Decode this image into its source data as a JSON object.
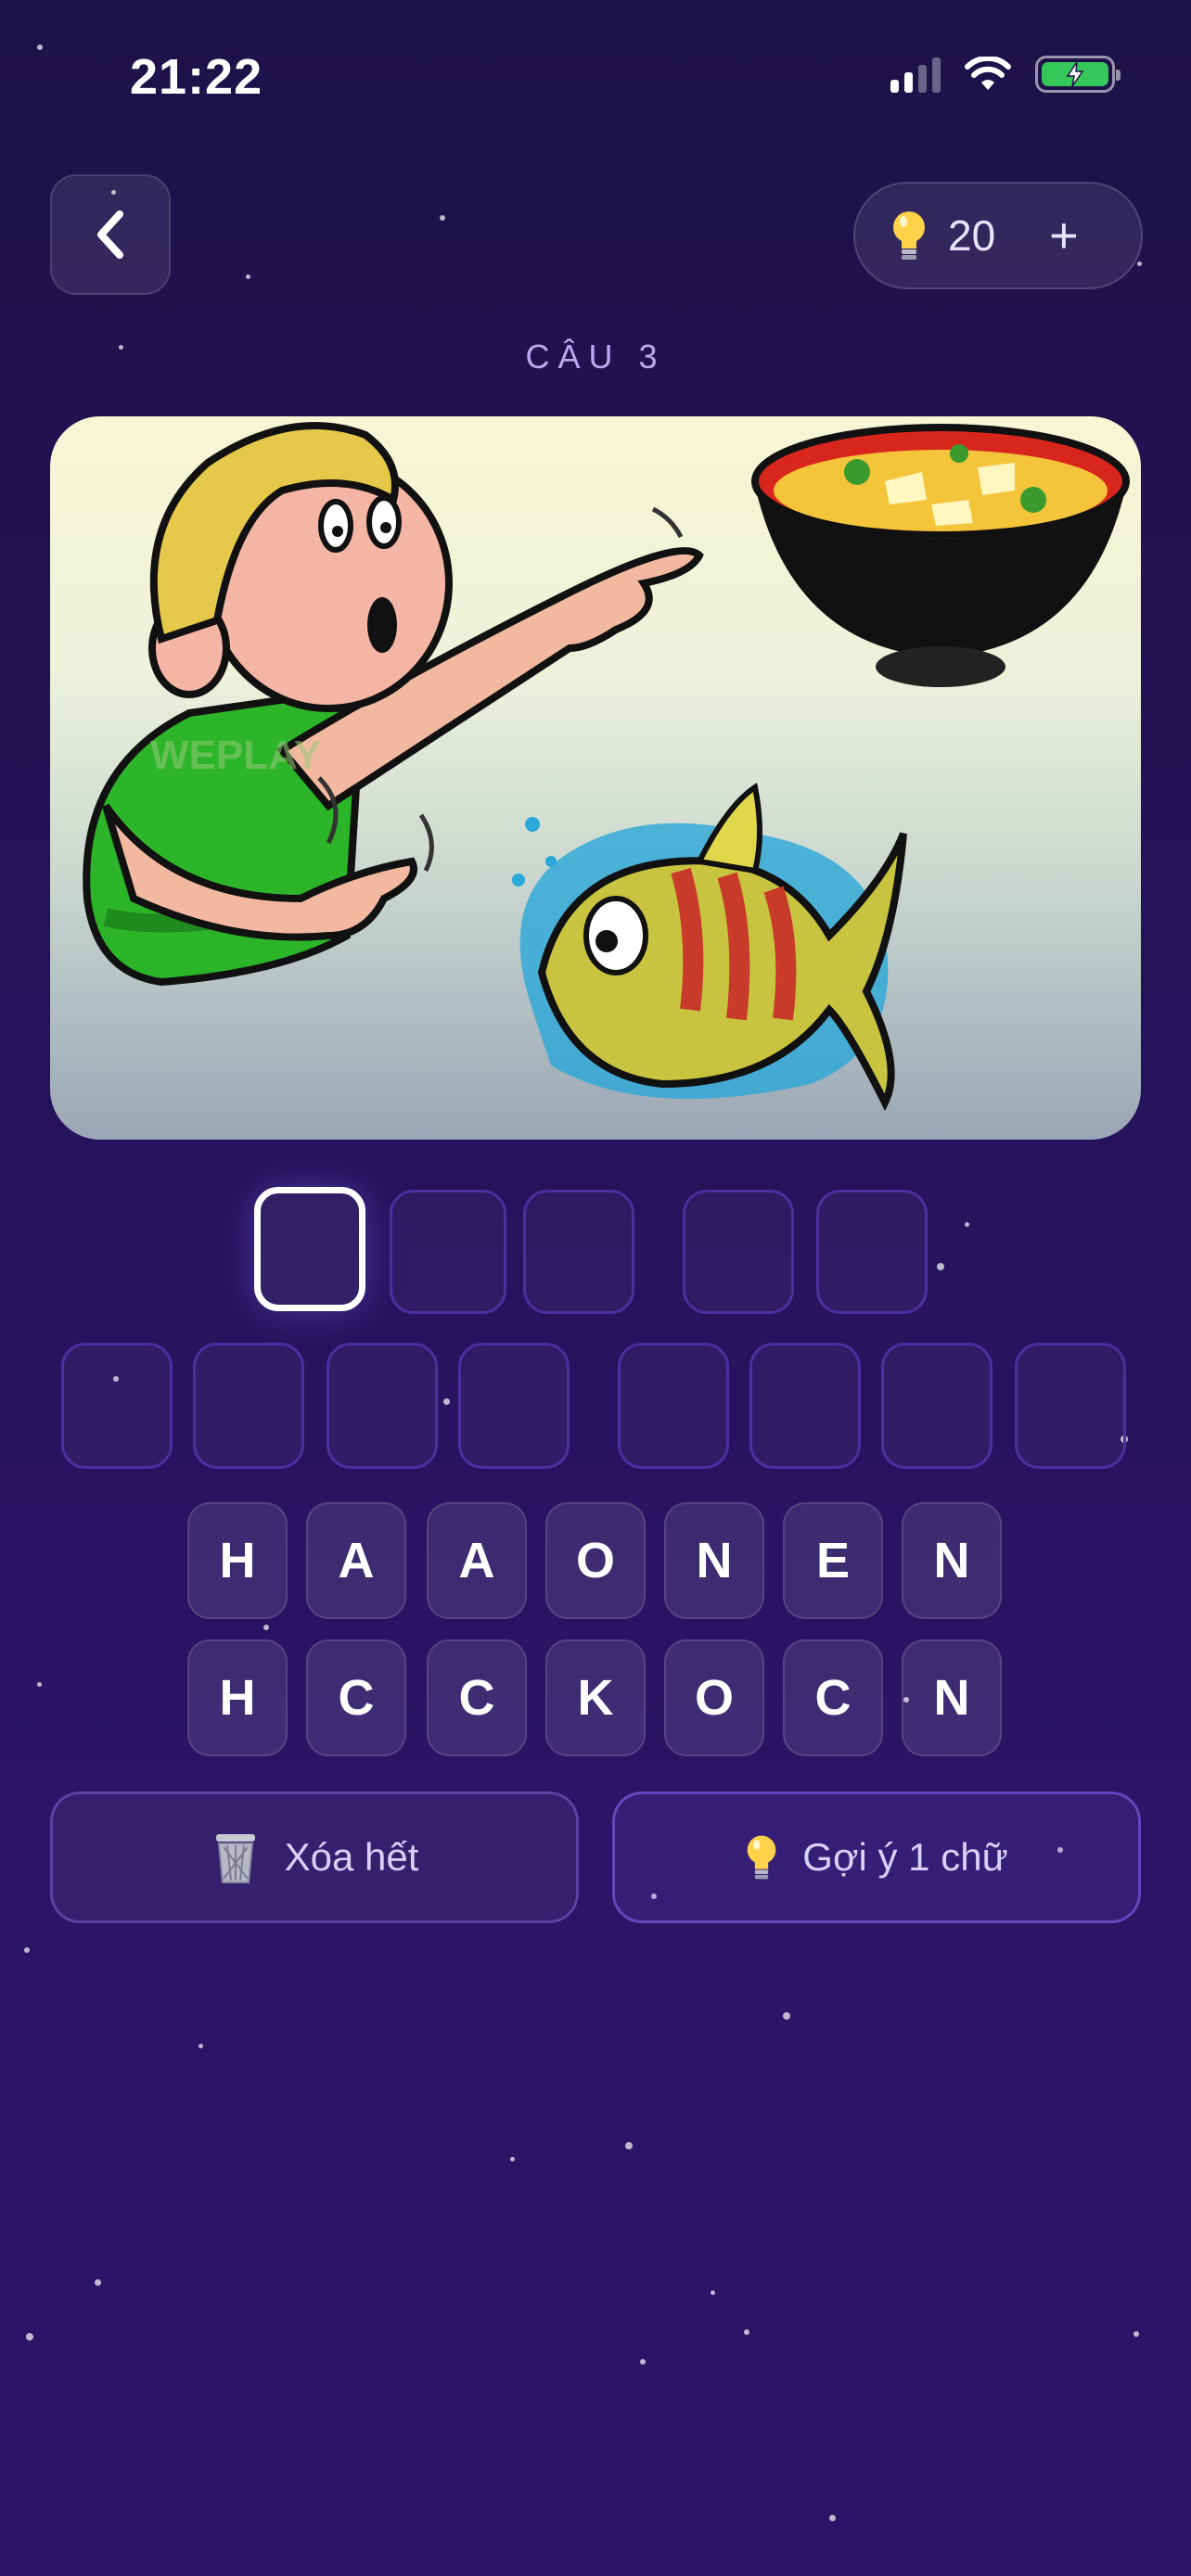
{
  "status_bar": {
    "time": "21:22",
    "signal_icon": "cellular-signal-icon",
    "wifi_icon": "wifi-icon",
    "battery_icon": "battery-charging-icon",
    "battery_color": "#35c759"
  },
  "header": {
    "back_icon": "chevron-left-icon",
    "hint_count": "20",
    "hint_plus": "+",
    "hint_icon": "lightbulb-icon"
  },
  "question": {
    "label": "CÂU 3"
  },
  "image": {
    "watermark": "WEPLAY",
    "description_icon": "puzzle-image"
  },
  "answer": {
    "row1": [
      "",
      "",
      "",
      "",
      ""
    ],
    "row2": [
      "",
      "",
      "",
      "",
      "",
      "",
      "",
      ""
    ],
    "active_index": 0
  },
  "keyboard": {
    "row1": [
      "H",
      "A",
      "A",
      "O",
      "N",
      "E",
      "N"
    ],
    "row2": [
      "H",
      "C",
      "C",
      "K",
      "O",
      "C",
      "N"
    ]
  },
  "actions": {
    "clear_label": "Xóa hết",
    "clear_icon": "trash-icon",
    "hint_label": "Gợi ý 1 chữ",
    "hint_icon": "lightbulb-icon"
  },
  "colors": {
    "background": "#24135a",
    "accent": "#4c2fa0",
    "label": "#b8a9f0"
  }
}
